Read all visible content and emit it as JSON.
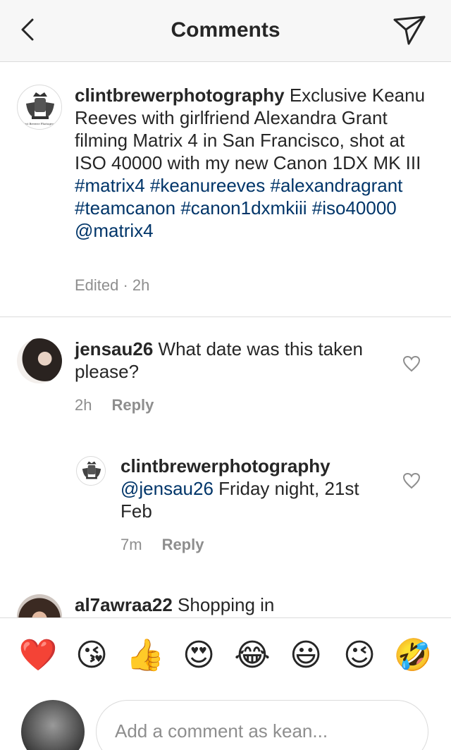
{
  "header": {
    "title": "Comments"
  },
  "post": {
    "username": "clintbrewerphotography",
    "text": "Exclusive Keanu Reeves with girlfriend Alexandra Grant filming Matrix 4 in San Francisco, shot at ISO 40000 with my new Canon 1DX MK III",
    "tags": "#matrix4 #keanureeves #alexandragrant #teamcanon #canon1dxmkiii #iso40000 @matrix4",
    "meta": "Edited · 2h"
  },
  "comments": [
    {
      "username": "jensau26",
      "text": "What date was this taken please?",
      "time": "2h",
      "reply_label": "Reply"
    },
    {
      "username": "clintbrewerphotography",
      "mention": "@jensau26",
      "text": "Friday night, 21st Feb",
      "time": "7m",
      "reply_label": "Reply"
    },
    {
      "username": "al7awraa22",
      "text": "Shopping in"
    }
  ],
  "emojis": [
    "❤️",
    "😘",
    "👍",
    "😍",
    "😂",
    "😃",
    "😉",
    "🤣"
  ],
  "composer": {
    "placeholder": "Add a comment as kean..."
  }
}
